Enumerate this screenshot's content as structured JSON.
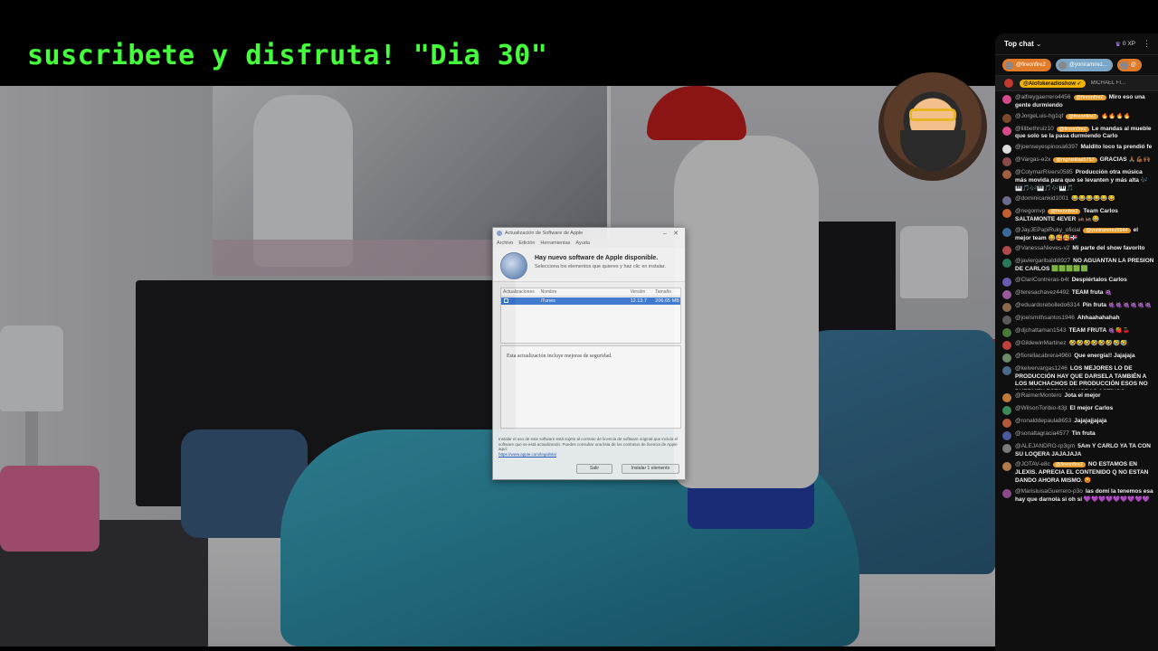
{
  "stream": {
    "overlay_title": "suscribete y disfruta! \"Dia 30\""
  },
  "dialog": {
    "title": "Actualización de Software de Apple",
    "menu": [
      "Archivo",
      "Edición",
      "Herramientas",
      "Ayuda"
    ],
    "headline": "Hay nuevo software de Apple disponible.",
    "subline": "Selecciona los elementos que quieres y haz clic en instalar.",
    "columns": [
      "Actualizaciones",
      "Nombre",
      "Versión",
      "Tamaño"
    ],
    "item": {
      "name": "iTunes",
      "version": "12.13.7",
      "size": "206.65 MB"
    },
    "description": "Esta actualización incluye mejoras de seguridad.",
    "license_text": "Instalar el uso de este software está sujeto al contrato de licencia de software original que incluía el software que se está actualizando. Puedes consultar una lista de los contratos de licencia de Apple aquí:",
    "license_link": "https://www.apple.com/legal/sla/",
    "quit_label": "Salir",
    "install_label": "Instalar 1 elemento"
  },
  "chat": {
    "title": "Top chat",
    "xp": "0 XP",
    "chips": [
      {
        "name": "@fireonfire2",
        "color": "#e07b2a"
      },
      {
        "name": "@yoniramirez...",
        "color": "#7aa7c7"
      },
      {
        "name": "@",
        "color": "#e07b2a"
      }
    ],
    "pinned": {
      "badge": "@Alofokeradioshow ✓",
      "name": "MICHAEL FI..."
    },
    "messages": [
      {
        "author": "@alfreygaerrero4456",
        "badge": "@fireonfire2",
        "text": "Miro eso una gente durmiendo",
        "color": "#d44a8a"
      },
      {
        "author": "@JorgeLuis-hg1qf",
        "badge": "@fireonfire2",
        "text": "🔥🔥🔥🔥",
        "color": "#7a4a2a"
      },
      {
        "author": "@lilibethruiz10",
        "badge": "@fireonfire2",
        "text": "Le mandas al mueble que solo se la pasa durmiendo Carlo",
        "color": "#d44a8a"
      },
      {
        "author": "@joenseyespinosa6397",
        "badge": "",
        "text": "Maldito loco ta prendió fe",
        "color": "#dddddd"
      },
      {
        "author": "@Vargas-e2x",
        "badge": "@mgnisklas5757",
        "text": "GRACIAS 🙏🏾💪🏾🙌🏾",
        "color": "#8a4a4a"
      },
      {
        "author": "@ColymarRivers0585",
        "badge": "",
        "text": "Producción otra música más movida para que se levanten y más alta 🎶🎹🎵🎶🎹🎵🎶🎹🎵",
        "color": "#a06040"
      },
      {
        "author": "@dominicankid1001",
        "badge": "",
        "text": "😂😂😂😂😂😂",
        "color": "#6a6a8a"
      },
      {
        "author": "@negomvp",
        "badge": "@fireonfire2",
        "text": "Team Carlos SALTAMONTE 4EVER 🦗🦗😂",
        "color": "#c06030"
      },
      {
        "author": "@JayJEPapiRuky_oficial",
        "badge": "@yoniramirez5944",
        "text": "el mejor team 😂🥰🥰🇩🇴",
        "color": "#3a6a9a"
      },
      {
        "author": "@VanessaNieves-v2",
        "badge": "",
        "text": "Mi parte del show favorito",
        "color": "#b04a4a"
      },
      {
        "author": "@javiergaribaldi8927",
        "badge": "",
        "text": "NO AGUANTAN LA PRESION DE CARLOS 🟩🟩🟩🟩🟩",
        "color": "#2a7a5a"
      },
      {
        "author": "@ClariContreras-b4t",
        "badge": "",
        "text": "Despiértalos Carlos",
        "color": "#6a5ab0"
      },
      {
        "author": "@teresachavez4492",
        "badge": "",
        "text": "TEAM fruta 🍇",
        "color": "#9a5a9a"
      },
      {
        "author": "@eduardorebolledo6314",
        "badge": "",
        "text": "Pin fruta 🍇🍇🍇🍇🍇🍇",
        "color": "#8a6a4a"
      },
      {
        "author": "@joelsmithsantos1946",
        "badge": "",
        "text": "Ahhaahahahah",
        "color": "#5a5a5a"
      },
      {
        "author": "@djchattaman1543",
        "badge": "",
        "text": "TEAM FRUTA 🍇🍓🍒",
        "color": "#4a7a3a"
      },
      {
        "author": "@GildewinMartinez",
        "badge": "",
        "text": "🤣🤣🤣🤣🤣🤣🤣🤣",
        "color": "#c04040"
      },
      {
        "author": "@fiorellacabrera4960",
        "badge": "",
        "text": "Que energía!! Jajajaja",
        "color": "#6a8a6a"
      },
      {
        "author": "@kelvervargas1246",
        "badge": "",
        "text": "LOS MEJORES LO DE PRODUCCIÓN HAY QUE DARSELA TAMBIÉN A LOS MUCHACHOS DE PRODUCCIÓN ESOS NO DUERMEN ESTAN 24 HORAS ACTIVOS",
        "color": "#4a6a8a"
      },
      {
        "author": "@RaimerMontero",
        "badge": "",
        "text": "Jota el mejor",
        "color": "#c07a3a"
      },
      {
        "author": "@WilsonToribio-lt3jt",
        "badge": "",
        "text": "El mejor Carlos",
        "color": "#3a8a5a"
      },
      {
        "author": "@ronalddepaula8653",
        "badge": "",
        "text": "Jajajajjajaja",
        "color": "#b05a3a"
      },
      {
        "author": "@sonaltagracia4577",
        "badge": "",
        "text": "Tin fruta",
        "color": "#4a5a9a"
      },
      {
        "author": "@ALEJANDRO-rp3gm",
        "badge": "",
        "text": "5Am Y CARLO YA TA CON SU LOQERA JAJAJAJA",
        "color": "#7a7a7a"
      },
      {
        "author": "@JOTAV-e8c",
        "badge": "@fireonfire2",
        "text": "NO ESTAMOS EN JLEXIS. APRECIA EL CONTENIDO Q NO ESTAN DANDO AHORA MISMO. 😡",
        "color": "#b07a4a"
      },
      {
        "author": "@MarisluisaGuerrero-p3o",
        "badge": "",
        "text": "las domí la tenemos esa hay que darnola si oh si 💜💜💜💜💜💜💜💜💜",
        "color": "#8a4a8a"
      }
    ]
  }
}
